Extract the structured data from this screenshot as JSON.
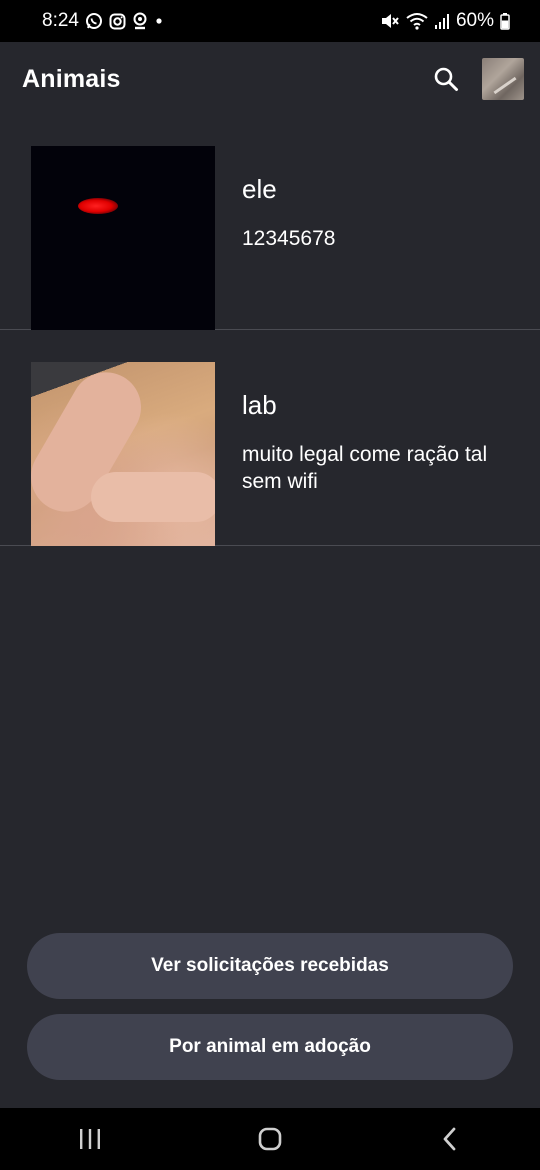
{
  "status_bar": {
    "time": "8:24",
    "battery": "60%",
    "icons_left": [
      "whatsapp-icon",
      "instagram-icon",
      "webcam-icon",
      "dot-icon"
    ],
    "icons_right": [
      "mute-icon",
      "wifi-icon",
      "signal-icon",
      "battery-icon"
    ]
  },
  "app_bar": {
    "title": "Animais",
    "search_icon": "search-icon"
  },
  "animals": [
    {
      "name": "ele",
      "description": "12345678"
    },
    {
      "name": "lab",
      "description": "muito legal come ração tal sem wifi"
    }
  ],
  "buttons": {
    "requests": "Ver solicitações recebidas",
    "adopt": "Por animal em adoção"
  },
  "nav_bar": {
    "recents": "recents-icon",
    "home": "home-icon",
    "back": "back-icon"
  },
  "colors": {
    "background": "#26272d",
    "button": "#40424f",
    "divider": "#4a4b52"
  }
}
